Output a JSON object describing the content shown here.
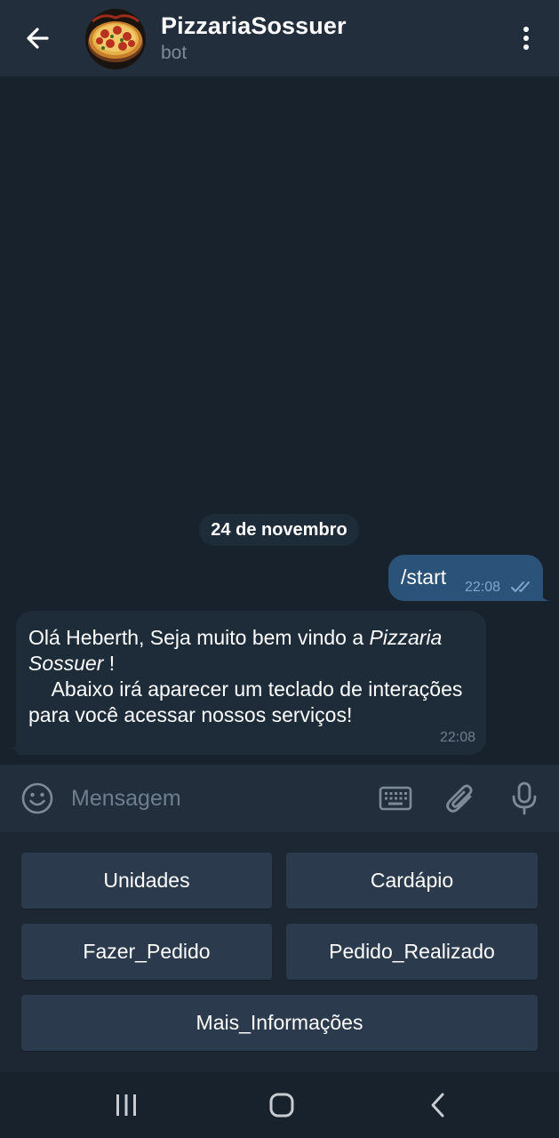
{
  "header": {
    "title": "PizzariaSossuer",
    "subtitle": "bot",
    "icons": [
      "back-arrow-icon",
      "pizza-avatar",
      "more-vertical-icon"
    ]
  },
  "chat": {
    "date_separator": "24 de novembro",
    "outgoing": {
      "text": "/start",
      "time": "22:08",
      "status_icon": "double-check-icon"
    },
    "incoming": {
      "line1_prefix": "Olá Heberth, Seja muito bem vindo a ",
      "line1_italic": "Pizzaria Sossuer",
      "line1_suffix": " !",
      "line2": "    Abaixo irá aparecer um teclado de interações para você acessar nossos serviços!",
      "time": "22:08"
    }
  },
  "composer": {
    "placeholder": "Mensagem",
    "icons": [
      "emoji-icon",
      "keyboard-icon",
      "attach-icon",
      "microphone-icon"
    ]
  },
  "keyboard": {
    "buttons": [
      "Unidades",
      "Cardápio",
      "Fazer_Pedido",
      "Pedido_Realizado",
      "Mais_Informações"
    ]
  },
  "system_nav": {
    "icons": [
      "recent-apps-icon",
      "home-icon",
      "system-back-icon"
    ]
  },
  "colors": {
    "header_bg": "#232e3c",
    "chat_bg": "#18222d",
    "outgoing_bubble": "#2b5278",
    "incoming_bubble": "#1e2c3a",
    "keyboard_button": "#2b3a4c",
    "muted_text": "#6d7f8f"
  }
}
